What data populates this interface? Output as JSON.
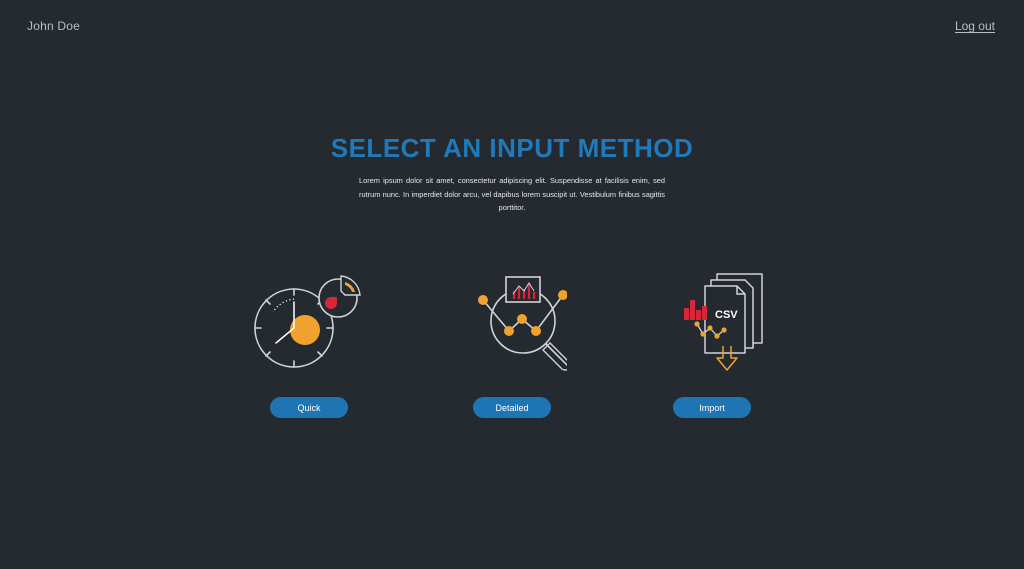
{
  "header": {
    "user_name": "John Doe",
    "logout_label": "Log out"
  },
  "main": {
    "title": "SELECT AN INPUT METHOD",
    "description": "Lorem ipsum dolor sit amet, consectetur adipiscing elit. Suspendisse at facilisis enim, sed rutrum nunc. In imperdiet dolor arcu, vel dapibus lorem suscipit ut. Vestibulum finibus sagittis porttitor.",
    "options": [
      {
        "icon": "stopwatch-pie-chart-icon",
        "button_label": "Quick"
      },
      {
        "icon": "magnifier-line-chart-icon",
        "button_label": "Detailed"
      },
      {
        "icon": "csv-documents-icon",
        "icon_text": "CSV",
        "button_label": "Import"
      }
    ]
  },
  "colors": {
    "background": "#242a30",
    "accent_blue": "#2079b9",
    "button_blue": "#1f74b3",
    "icon_orange": "#f0a22e",
    "icon_red": "#d5263a",
    "icon_line": "#d0d3d6"
  }
}
